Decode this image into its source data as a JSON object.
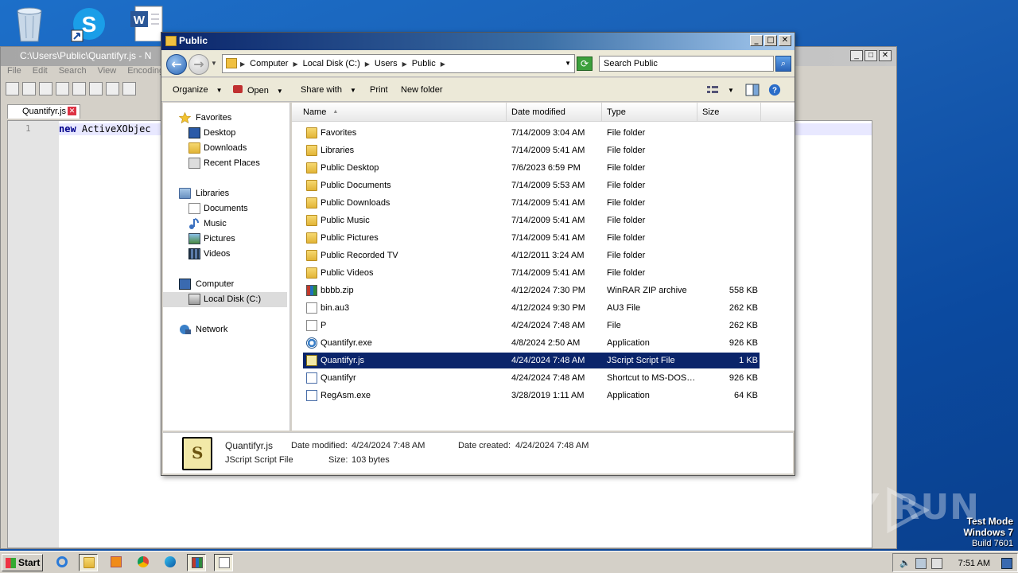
{
  "desktop": {
    "icons": [
      "recycle-bin",
      "skype",
      "word-document"
    ],
    "watermark": "ANY RUN",
    "testmode": {
      "line1": "Test Mode",
      "line2": "Windows 7",
      "line3": "Build 7601"
    }
  },
  "notepad": {
    "title": "C:\\Users\\Public\\Quantifyr.js - N",
    "menu": [
      "File",
      "Edit",
      "Search",
      "View",
      "Encoding"
    ],
    "tab": "Quantifyr.js",
    "line_number": "1",
    "code_keyword": "new",
    "code_rest": " ActiveXObjec"
  },
  "explorer": {
    "title": "Public",
    "breadcrumb": [
      "Computer",
      "Local Disk (C:)",
      "Users",
      "Public"
    ],
    "search_placeholder": "Search Public",
    "commands": {
      "organize": "Organize",
      "open": "Open",
      "share": "Share with",
      "print": "Print",
      "new_folder": "New folder"
    },
    "nav": {
      "favorites": "Favorites",
      "desktop": "Desktop",
      "downloads": "Downloads",
      "recent": "Recent Places",
      "libraries": "Libraries",
      "documents": "Documents",
      "music": "Music",
      "pictures": "Pictures",
      "videos": "Videos",
      "computer": "Computer",
      "local_disk": "Local Disk (C:)",
      "network": "Network"
    },
    "columns": {
      "name": "Name",
      "date": "Date modified",
      "type": "Type",
      "size": "Size"
    },
    "files": [
      {
        "name": "Favorites",
        "date": "7/14/2009 3:04 AM",
        "type": "File folder",
        "size": "",
        "icon": "folder"
      },
      {
        "name": "Libraries",
        "date": "7/14/2009 5:41 AM",
        "type": "File folder",
        "size": "",
        "icon": "folder"
      },
      {
        "name": "Public Desktop",
        "date": "7/6/2023 6:59 PM",
        "type": "File folder",
        "size": "",
        "icon": "folder"
      },
      {
        "name": "Public Documents",
        "date": "7/14/2009 5:53 AM",
        "type": "File folder",
        "size": "",
        "icon": "folder"
      },
      {
        "name": "Public Downloads",
        "date": "7/14/2009 5:41 AM",
        "type": "File folder",
        "size": "",
        "icon": "folder"
      },
      {
        "name": "Public Music",
        "date": "7/14/2009 5:41 AM",
        "type": "File folder",
        "size": "",
        "icon": "folder"
      },
      {
        "name": "Public Pictures",
        "date": "7/14/2009 5:41 AM",
        "type": "File folder",
        "size": "",
        "icon": "folder"
      },
      {
        "name": "Public Recorded TV",
        "date": "4/12/2011 3:24 AM",
        "type": "File folder",
        "size": "",
        "icon": "folder"
      },
      {
        "name": "Public Videos",
        "date": "7/14/2009 5:41 AM",
        "type": "File folder",
        "size": "",
        "icon": "folder"
      },
      {
        "name": "bbbb.zip",
        "date": "4/12/2024 7:30 PM",
        "type": "WinRAR ZIP archive",
        "size": "558 KB",
        "icon": "zip"
      },
      {
        "name": "bin.au3",
        "date": "4/12/2024 9:30 PM",
        "type": "AU3 File",
        "size": "262 KB",
        "icon": "file"
      },
      {
        "name": "P",
        "date": "4/24/2024 7:48 AM",
        "type": "File",
        "size": "262 KB",
        "icon": "file"
      },
      {
        "name": "Quantifyr.exe",
        "date": "4/8/2024 2:50 AM",
        "type": "Application",
        "size": "926 KB",
        "icon": "exe"
      },
      {
        "name": "Quantifyr.js",
        "date": "4/24/2024 7:48 AM",
        "type": "JScript Script File",
        "size": "1 KB",
        "icon": "js",
        "selected": true
      },
      {
        "name": "Quantifyr",
        "date": "4/24/2024 7:48 AM",
        "type": "Shortcut to MS-DOS…",
        "size": "926 KB",
        "icon": "lnk"
      },
      {
        "name": "RegAsm.exe",
        "date": "3/28/2019 1:11 AM",
        "type": "Application",
        "size": "64 KB",
        "icon": "lnk"
      }
    ],
    "details": {
      "name": "Quantifyr.js",
      "type": "JScript Script File",
      "modified_label": "Date modified:",
      "modified": "4/24/2024 7:48 AM",
      "created_label": "Date created:",
      "created": "4/24/2024 7:48 AM",
      "size_label": "Size:",
      "size": "103 bytes"
    }
  },
  "taskbar": {
    "start": "Start",
    "apps": [
      "internet-explorer",
      "explorer",
      "media-player",
      "chrome",
      "edge",
      "winrar",
      "notepad"
    ],
    "clock": "7:51 AM"
  }
}
